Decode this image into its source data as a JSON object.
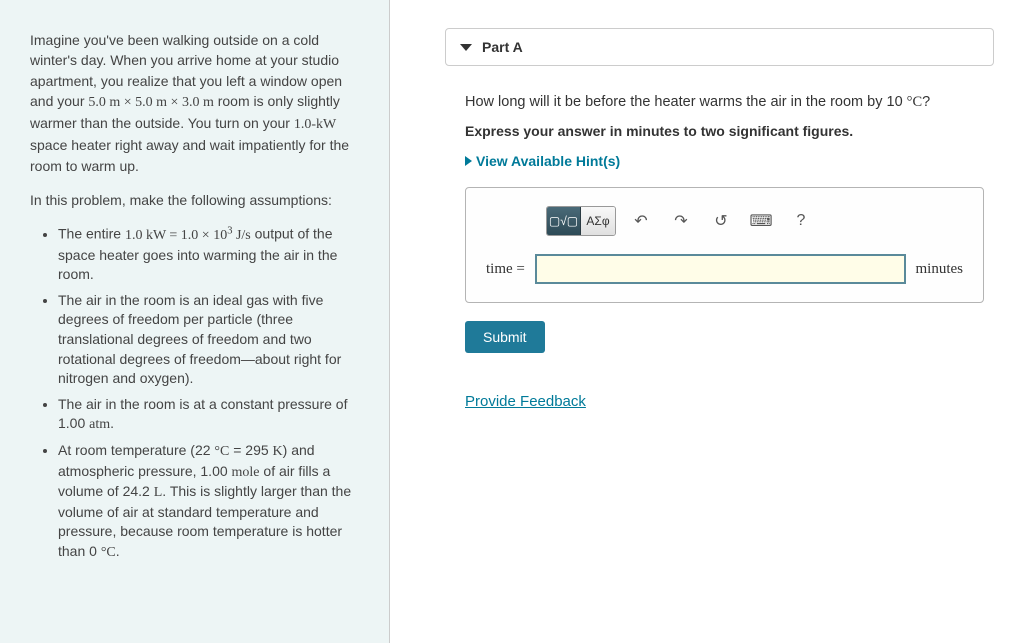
{
  "problem": {
    "intro": "Imagine you've been walking outside on a cold winter's day. When you arrive home at your studio apartment, you realize that you left a window open and your ",
    "dimensions": "5.0 m × 5.0 m × 3.0 m",
    "intro2": " room is only slightly warmer than the outside. You turn on your ",
    "heater_power": "1.0-kW",
    "intro3": " space heater right away and wait impatiently for the room to warm up.",
    "assumptions_lead": "In this problem, make the following assumptions:",
    "bullets": {
      "b1a": "The entire ",
      "b1_eq": "1.0 kW = 1.0 × 10",
      "b1_exp": "3",
      "b1_unit": " J/s",
      "b1b": " output of the space heater goes into warming the air in the room.",
      "b2": "The air in the room is an ideal gas with five degrees of freedom per particle (three translational degrees of freedom and two rotational degrees of freedom—about right for nitrogen and oxygen).",
      "b3a": "The air in the room is at a constant pressure of 1.00 ",
      "b3_unit": "atm",
      "b3b": ".",
      "b4a": "At room temperature (22 ",
      "b4_deg": "°C",
      "b4b": " = 295 ",
      "b4_K": "K",
      "b4c": ") and atmospheric pressure, 1.00 ",
      "b4_mole": "mole",
      "b4d": " of air fills a volume of 24.2 ",
      "b4_L": "L",
      "b4e": ". This is slightly larger than the volume of air at standard temperature and pressure, because room temperature is hotter than 0 ",
      "b4_deg2": "°C",
      "b4f": "."
    }
  },
  "part": {
    "label": "Part A",
    "question_a": "How long will it be before the heater warms the air in the room by 10 ",
    "question_deg": "°C",
    "question_b": "?",
    "instruction": "Express your answer in minutes to two significant figures.",
    "hints": "View Available Hint(s)",
    "toolbar": {
      "templates": "▢√▢",
      "greek": "ΑΣφ",
      "undo": "↶",
      "redo": "↷",
      "reset": "↺",
      "keyboard": "⌨",
      "help": "?"
    },
    "input_label": "time =",
    "input_value": "",
    "unit": "minutes",
    "submit": "Submit"
  },
  "feedback_link": "Provide Feedback"
}
